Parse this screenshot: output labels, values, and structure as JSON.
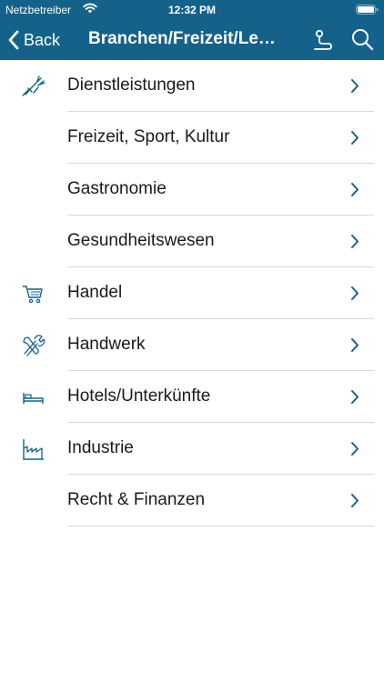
{
  "status_bar": {
    "carrier": "Netzbetreiber",
    "time": "12:32 PM"
  },
  "nav": {
    "back_label": "Back",
    "title": "Branchen/Freizeit/Le…"
  },
  "colors": {
    "header_bg": "#14628a",
    "accent": "#14628a",
    "divider": "#d9d9d9"
  },
  "categories": [
    {
      "label": "Dienstleistungen",
      "icon": "services-icon"
    },
    {
      "label": "Freizeit, Sport, Kultur",
      "icon": null
    },
    {
      "label": "Gastronomie",
      "icon": null
    },
    {
      "label": "Gesundheitswesen",
      "icon": null
    },
    {
      "label": "Handel",
      "icon": "shopping-cart-icon"
    },
    {
      "label": "Handwerk",
      "icon": "tools-icon"
    },
    {
      "label": "Hotels/Unterkünfte",
      "icon": "bed-icon"
    },
    {
      "label": "Industrie",
      "icon": "factory-icon"
    },
    {
      "label": "Recht & Finanzen",
      "icon": null
    }
  ]
}
